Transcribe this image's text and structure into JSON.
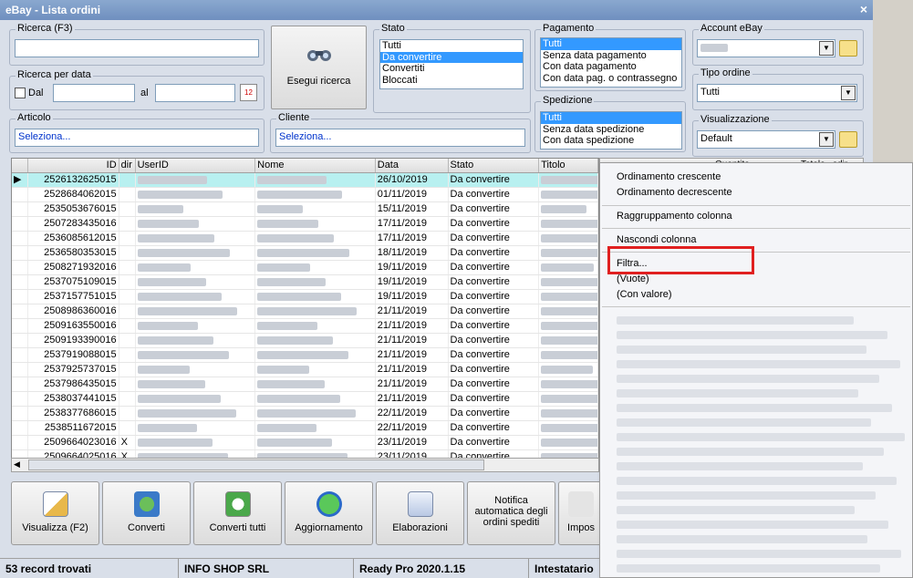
{
  "window": {
    "title": "eBay - Lista ordini",
    "close": "×"
  },
  "search": {
    "label": "Ricerca (F3)",
    "value": ""
  },
  "date_search": {
    "label": "Ricerca per data",
    "dal": "Dal",
    "al": "al",
    "from": "",
    "to": ""
  },
  "run_search": {
    "label": "Esegui ricerca"
  },
  "article": {
    "label": "Articolo",
    "value": "Seleziona..."
  },
  "client": {
    "label": "Cliente",
    "value": "Seleziona..."
  },
  "stato": {
    "label": "Stato",
    "options": [
      "Tutti",
      "Da convertire",
      "Convertiti",
      "Bloccati"
    ],
    "selected": 1
  },
  "pagamento": {
    "label": "Pagamento",
    "options": [
      "Tutti",
      "Senza data pagamento",
      "Con data pagamento",
      "Con data pag. o contrassegno"
    ],
    "selected": 0
  },
  "spedizione": {
    "label": "Spedizione",
    "options": [
      "Tutti",
      "Senza data spedizione",
      "Con data spedizione"
    ],
    "selected": 0
  },
  "account": {
    "label": "Account eBay",
    "value": ""
  },
  "tipo_ordine": {
    "label": "Tipo ordine",
    "value": "Tutti"
  },
  "visualizzazione": {
    "label": "Visualizzazione",
    "value": "Default"
  },
  "grid": {
    "columns": [
      "",
      "ID",
      "dir",
      "UserID",
      "Nome",
      "Data",
      "Stato",
      "Titolo"
    ],
    "right_columns": [
      "Quantita",
      "Totale",
      "sdir"
    ],
    "rows": [
      {
        "id": "2526132625015",
        "dir": "",
        "date": "26/10/2019",
        "stato": "Da convertire",
        "selected": true
      },
      {
        "id": "2528684062015",
        "dir": "",
        "date": "01/11/2019",
        "stato": "Da convertire"
      },
      {
        "id": "2535053676015",
        "dir": "",
        "date": "15/11/2019",
        "stato": "Da convertire"
      },
      {
        "id": "2507283435016",
        "dir": "",
        "date": "17/11/2019",
        "stato": "Da convertire"
      },
      {
        "id": "2536085612015",
        "dir": "",
        "date": "17/11/2019",
        "stato": "Da convertire"
      },
      {
        "id": "2536580353015",
        "dir": "",
        "date": "18/11/2019",
        "stato": "Da convertire"
      },
      {
        "id": "2508271932016",
        "dir": "",
        "date": "19/11/2019",
        "stato": "Da convertire"
      },
      {
        "id": "2537075109015",
        "dir": "",
        "date": "19/11/2019",
        "stato": "Da convertire"
      },
      {
        "id": "2537157751015",
        "dir": "",
        "date": "19/11/2019",
        "stato": "Da convertire"
      },
      {
        "id": "2508986360016",
        "dir": "",
        "date": "21/11/2019",
        "stato": "Da convertire"
      },
      {
        "id": "2509163550016",
        "dir": "",
        "date": "21/11/2019",
        "stato": "Da convertire"
      },
      {
        "id": "2509193390016",
        "dir": "",
        "date": "21/11/2019",
        "stato": "Da convertire"
      },
      {
        "id": "2537919088015",
        "dir": "",
        "date": "21/11/2019",
        "stato": "Da convertire"
      },
      {
        "id": "2537925737015",
        "dir": "",
        "date": "21/11/2019",
        "stato": "Da convertire"
      },
      {
        "id": "2537986435015",
        "dir": "",
        "date": "21/11/2019",
        "stato": "Da convertire"
      },
      {
        "id": "2538037441015",
        "dir": "",
        "date": "21/11/2019",
        "stato": "Da convertire"
      },
      {
        "id": "2538377686015",
        "dir": "",
        "date": "22/11/2019",
        "stato": "Da convertire"
      },
      {
        "id": "2538511672015",
        "dir": "",
        "date": "22/11/2019",
        "stato": "Da convertire"
      },
      {
        "id": "2509664023016",
        "dir": "X",
        "date": "23/11/2019",
        "stato": "Da convertire"
      },
      {
        "id": "2509664025016",
        "dir": "X",
        "date": "23/11/2019",
        "stato": "Da convertire"
      }
    ]
  },
  "toolbar": {
    "visualizza": "Visualizza (F2)",
    "converti": "Converti",
    "converti_tutti": "Converti tutti",
    "aggiornamento": "Aggiornamento",
    "elaborazioni": "Elaborazioni",
    "notifica": "Notifica automatica degli ordini spediti",
    "impos": "Impos"
  },
  "status": {
    "records": "53 record trovati",
    "company": "INFO SHOP SRL",
    "version": "Ready Pro 2020.1.15",
    "holder": "Intestatario"
  },
  "context_menu": {
    "sort_asc": "Ordinamento crescente",
    "sort_desc": "Ordinamento decrescente",
    "group": "Raggruppamento colonna",
    "hide": "Nascondi colonna",
    "filter": "Filtra...",
    "empty": "(Vuote)",
    "with_value": "(Con valore)"
  },
  "colors": {
    "selection": "#3399ff",
    "highlight_box": "#e02020",
    "row_selected": "#b8f0f0"
  }
}
